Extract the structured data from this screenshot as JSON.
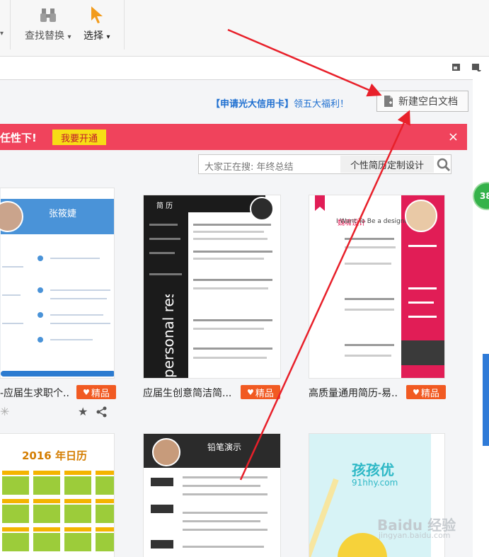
{
  "ribbon": {
    "find_replace_label": "查找替换",
    "select_label": "选择",
    "caret": "▾"
  },
  "panel": {
    "promo_bracketed": "【申请光大信用卡】",
    "promo_text": "领五大福利！",
    "new_blank_doc": "新建空白文档"
  },
  "banner": {
    "text": "任性下!",
    "cta": "我要开通",
    "close": "×",
    "color": "#f0435c"
  },
  "search": {
    "placeholder": "大家正在搜: 年终总结",
    "tag": "个性简历定制设计"
  },
  "cards": [
    {
      "title": "-应届生求职个..",
      "premium": "精品",
      "name_on_thumb": "张筱婕"
    },
    {
      "title": "应届生创意简洁简...",
      "premium": "精品",
      "thumb_heading": "简 历",
      "thumb_vertical": "personal resume"
    },
    {
      "title": "高质量通用简历-易..",
      "premium": "精品",
      "thumb_heading": "魏啸设计",
      "thumb_tagline": "I Want  To  Be a designer"
    }
  ],
  "bottom_cards": [
    {
      "heading": "2016 年日历"
    },
    {
      "name": "铅笔演示"
    },
    {
      "brand": "孩孩优",
      "url": "91hhy.com"
    }
  ],
  "side_badge": "38",
  "watermark": {
    "brand": "Baidu 经验",
    "url": "jingyan.baidu.com"
  },
  "colors": {
    "accent_blue": "#1e6fd0",
    "premium_orange": "#f15a22",
    "cta_yellow": "#f7dd15",
    "arrow_red": "#e8202a"
  }
}
